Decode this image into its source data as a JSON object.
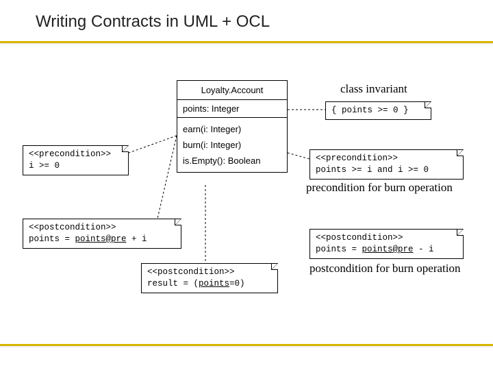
{
  "title": "Writing Contracts in UML + OCL",
  "uml": {
    "name": "Loyalty.Account",
    "attr": "points: Integer",
    "op_earn": "earn(i: Integer)",
    "op_burn": "burn(i: Integer)",
    "op_isempty": "is.Empty(): Boolean"
  },
  "labels": {
    "class_invariant": "class invariant",
    "precond_burn": "precondition for burn operation",
    "postcond_burn": "postcondition for burn operation"
  },
  "notes": {
    "invariant": "{ points >= 0 }",
    "pre_earn_l1": "<<precondition>>",
    "pre_earn_l2": "i >= 0",
    "pre_burn_l1": "<<precondition>>",
    "pre_burn_l2": "points >= i and i >= 0",
    "post_earn_l1": "<<postcondition>>",
    "post_earn_l2a": "points = ",
    "post_earn_l2b": "points@pre",
    "post_earn_l2c": " + i",
    "post_burn_l1": "<<postcondition>>",
    "post_burn_l2a": "points = ",
    "post_burn_l2b": "points@pre",
    "post_burn_l2c": " - i",
    "post_empty_l1": "<<postcondition>>",
    "post_empty_l2a": "result = (",
    "post_empty_l2b": "points",
    "post_empty_l2c": "=0)"
  }
}
